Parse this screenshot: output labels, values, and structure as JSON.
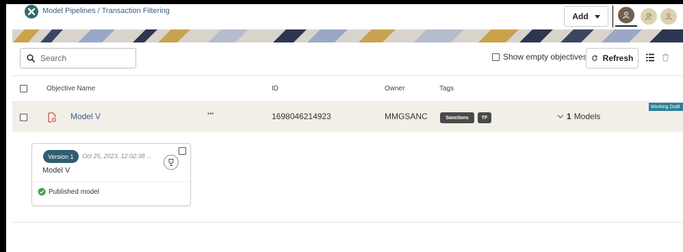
{
  "header": {
    "breadcrumb": "Model Pipelines / Transaction Filtering",
    "add_label": "Add"
  },
  "toolbar": {
    "search_placeholder": "Search",
    "show_empty_label": "Show empty objectives",
    "refresh_label": "Refresh"
  },
  "table": {
    "columns": [
      "Objective Name",
      "ID",
      "Owner",
      "Tags"
    ],
    "row": {
      "name": "Model V",
      "more": "•••",
      "id": "1698046214923",
      "owner": "MMGSANC",
      "tags": [
        "Sanctions",
        "TF"
      ],
      "models_count": "1",
      "models_label": "Models",
      "status_badge": "Working Draft"
    }
  },
  "version_card": {
    "version_label": "Version 1",
    "date": "Oct 25, 2023, 12:02:38 ...",
    "model_name": "Model V",
    "status": "Published model"
  },
  "colors": {
    "accent_link": "#3a5d86",
    "version_pill": "#2f5d72",
    "published_green": "#4a9b4f",
    "working_draft_badge": "#2d7f9a",
    "row_highlight": "#f2efe8",
    "model_icon": "#c0553a"
  },
  "icons": [
    "app-logo-icon",
    "chevron-down-icon",
    "user-icon",
    "search-icon",
    "refresh-icon",
    "list-view-icon",
    "delete-icon",
    "model-file-icon",
    "trophy-icon",
    "check-circle-icon"
  ]
}
